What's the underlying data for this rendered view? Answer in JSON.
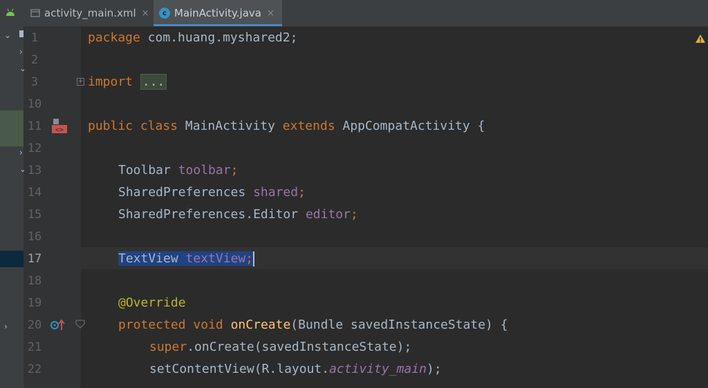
{
  "tabs": [
    {
      "label": "activity_main.xml",
      "close": "×",
      "icon": "xml-layout-icon",
      "active": false
    },
    {
      "label": "MainActivity.java",
      "close": "×",
      "icon": "java-class-icon",
      "active": true
    }
  ],
  "gutter": {
    "fold_collapsed": "+",
    "lines": [
      "1",
      "2",
      "3",
      "10",
      "11",
      "12",
      "13",
      "14",
      "15",
      "16",
      "17",
      "18",
      "19",
      "20",
      "21",
      "22"
    ],
    "current_line": "17"
  },
  "code": {
    "package": {
      "kw": "package",
      "rest": " com.huang.myshared2;"
    },
    "import": {
      "kw": "import",
      "folded": "..."
    },
    "class_decl": {
      "kw1": "public",
      "kw2": "class",
      "name": "MainActivity",
      "kw3": "extends",
      "parent": "AppCompatActivity {"
    },
    "toolbar": {
      "type": "Toolbar",
      "field": "toolbar",
      "semi": ";"
    },
    "shared": {
      "type": "SharedPreferences",
      "field": "shared",
      "semi": ";"
    },
    "editor": {
      "type": "SharedPreferences.Editor",
      "field": "editor",
      "semi": ";"
    },
    "textview": {
      "type": "TextView",
      "field": "textView",
      "semi": ";"
    },
    "override": "@Override",
    "oncreate": {
      "kw1": "protected",
      "kw2": "void",
      "method": "onCreate",
      "params": "(Bundle savedInstanceState) {"
    },
    "super_call": {
      "kw": "super",
      "rest": ".onCreate(savedInstanceState);"
    },
    "setcontent": {
      "pre": "setContentView(R.layout.",
      "italic": "activity_main",
      "post": ");"
    }
  },
  "colors": {
    "background": "#2b2b2b",
    "keyword": "#cc7832",
    "field": "#9876aa",
    "annotation": "#bbb529",
    "method": "#ffc66d",
    "selection": "#214283",
    "warning": "#e5b03b"
  }
}
